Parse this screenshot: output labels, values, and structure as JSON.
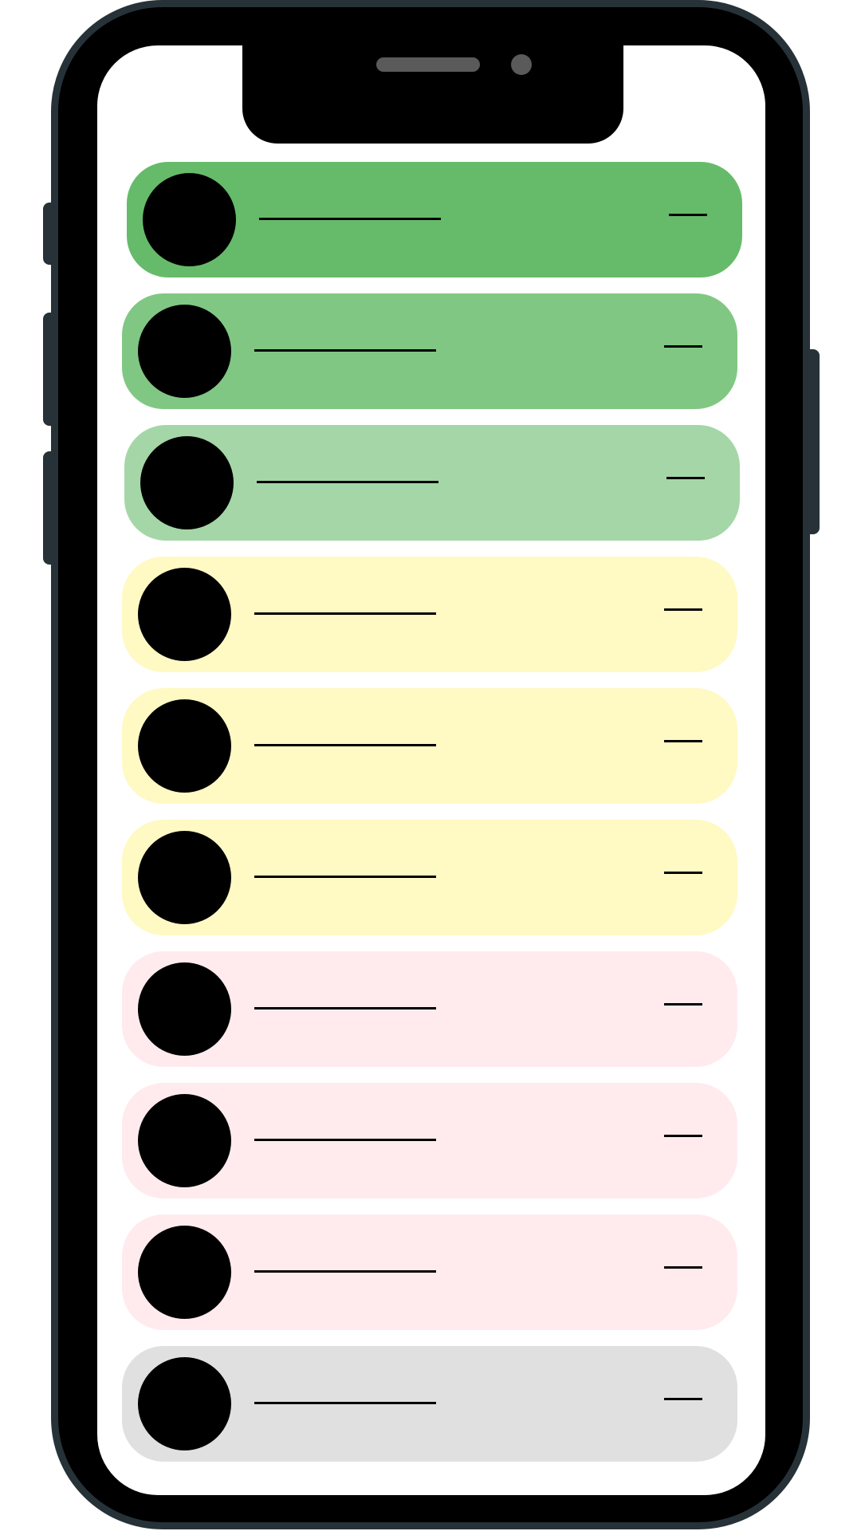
{
  "colors": {
    "frame": "#000000",
    "frame_outline": "#263238",
    "screen": "#ffffff",
    "green_dark": "#66bb6a",
    "green_mid": "#81c784",
    "green_light": "#a5d6a7",
    "yellow": "#fff9c4",
    "pink": "#ffebee",
    "gray": "#e0e0e0"
  },
  "list": {
    "items": [
      {
        "color": "#66bb6a"
      },
      {
        "color": "#81c784"
      },
      {
        "color": "#a5d6a7"
      },
      {
        "color": "#fff9c4"
      },
      {
        "color": "#fff9c4"
      },
      {
        "color": "#fff9c4"
      },
      {
        "color": "#ffebee"
      },
      {
        "color": "#ffebee"
      },
      {
        "color": "#ffebee"
      },
      {
        "color": "#e0e0e0"
      }
    ]
  }
}
